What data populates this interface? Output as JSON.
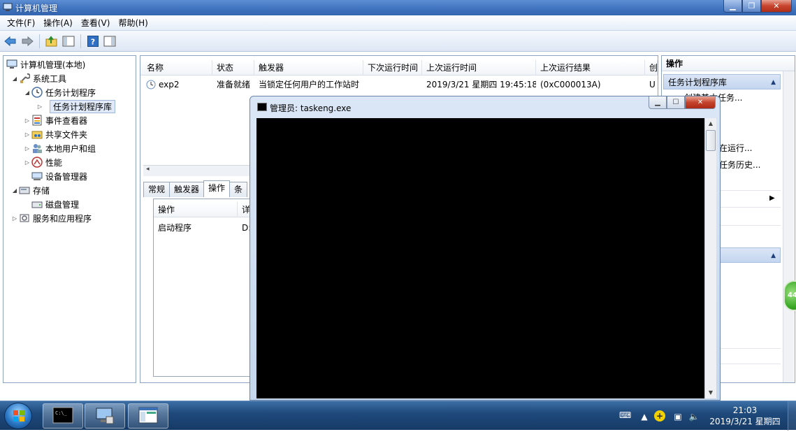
{
  "window": {
    "title": "计算机管理"
  },
  "menu": [
    "文件(F)",
    "操作(A)",
    "查看(V)",
    "帮助(H)"
  ],
  "tree": {
    "root": "计算机管理(本地)",
    "system_tools": "系统工具",
    "task_scheduler": "任务计划程序",
    "task_library": "任务计划程序库",
    "event_viewer": "事件查看器",
    "shared_folders": "共享文件夹",
    "local_users": "本地用户和组",
    "performance": "性能",
    "device_manager": "设备管理器",
    "storage": "存储",
    "disk_management": "磁盘管理",
    "services_apps": "服务和应用程序"
  },
  "task_list": {
    "headers": [
      "名称",
      "状态",
      "触发器",
      "下次运行时间",
      "上次运行时间",
      "上次运行结果",
      "创"
    ],
    "row": {
      "name": "exp2",
      "status": "准备就绪",
      "trigger": "当锁定任何用户的工作站时",
      "next_run": "",
      "last_run": "2019/3/21 星期四 19:45:18",
      "last_result": "(0xC000013A)",
      "creator": "U"
    }
  },
  "detail_tabs": [
    "常规",
    "触发器",
    "操作",
    "条"
  ],
  "actions_table": {
    "headers": [
      "操作",
      "详"
    ],
    "row": {
      "action": "启动程序",
      "detail": "D:"
    }
  },
  "actions_pane": {
    "header": "操作",
    "section1": "任务计划程序库",
    "items": [
      "创建基本任务...",
      "在运行...",
      "任务历史..."
    ]
  },
  "console": {
    "title": "管理员: taskeng.exe"
  },
  "taskbar": {
    "time": "21:03",
    "date": "2019/3/21 星期四"
  },
  "green_widget": "44"
}
